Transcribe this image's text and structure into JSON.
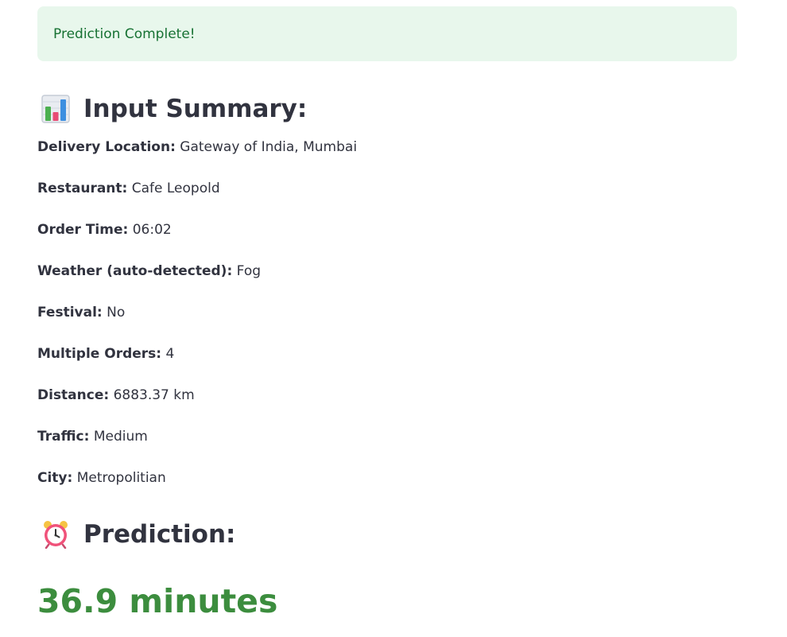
{
  "alert": {
    "message": "Prediction Complete!"
  },
  "summary": {
    "title": "Input Summary:",
    "icon": "bar-chart-icon",
    "rows": [
      {
        "label": "Delivery Location:",
        "value": "Gateway of India, Mumbai"
      },
      {
        "label": "Restaurant:",
        "value": "Cafe Leopold"
      },
      {
        "label": "Order Time:",
        "value": "06:02"
      },
      {
        "label": "Weather (auto-detected):",
        "value": "Fog"
      },
      {
        "label": "Festival:",
        "value": "No"
      },
      {
        "label": "Multiple Orders:",
        "value": "4"
      },
      {
        "label": "Distance:",
        "value": "6883.37 km"
      },
      {
        "label": "Traffic:",
        "value": "Medium"
      },
      {
        "label": "City:",
        "value": "Metropolitian"
      }
    ]
  },
  "prediction": {
    "title": "Prediction:",
    "icon": "alarm-clock-icon",
    "value": "36.9 minutes"
  },
  "colors": {
    "alert_bg": "#e8f7ec",
    "alert_text": "#177233",
    "result_text": "#3c8d3e",
    "body_text": "#31333f"
  }
}
